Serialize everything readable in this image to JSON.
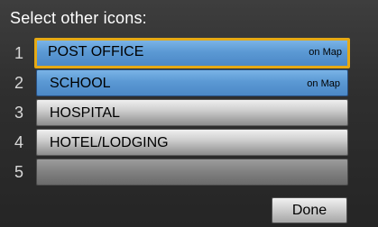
{
  "title": "Select other icons:",
  "items": [
    {
      "number": "1",
      "label": "POST OFFICE",
      "status": "on Map"
    },
    {
      "number": "2",
      "label": "SCHOOL",
      "status": "on Map"
    },
    {
      "number": "3",
      "label": "HOSPITAL",
      "status": ""
    },
    {
      "number": "4",
      "label": "HOTEL/LODGING",
      "status": ""
    },
    {
      "number": "5",
      "label": "",
      "status": ""
    }
  ],
  "done_label": "Done",
  "colors": {
    "selected": "#5b99d4",
    "focus_border": "#e5a915",
    "background": "#2f2f2f"
  }
}
